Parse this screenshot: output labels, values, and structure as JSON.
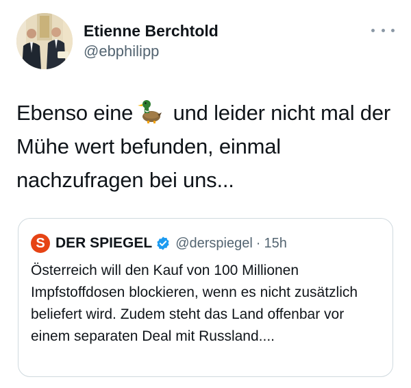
{
  "author": {
    "display_name": "Etienne Berchtold",
    "handle": "@ebphilipp"
  },
  "tweet": {
    "text_before_emoji": "Ebenso eine",
    "emoji_icon": "duck-icon",
    "text_after_emoji": " und leider nicht mal der Mühe wert befunden, einmal nachzufragen bei uns..."
  },
  "quoted_tweet": {
    "logo_letter": "S",
    "display_name": "DER SPIEGEL",
    "verified": true,
    "handle": "@derspiegel",
    "separator": "·",
    "time": "15h",
    "text": "Österreich will den Kauf von 100 Millionen Impfstoffdosen blockieren, wenn es nicht zusätzlich beliefert wird. Zudem steht das Land offenbar vor einem separaten Deal mit Russland...."
  },
  "colors": {
    "text_primary": "#0f1419",
    "text_secondary": "#536471",
    "border": "#cfd9de",
    "verified": "#1d9bf0",
    "spiegel_brand": "#e64415"
  },
  "icons": {
    "more": "more-horizontal-icon",
    "verified": "verified-badge-icon"
  }
}
